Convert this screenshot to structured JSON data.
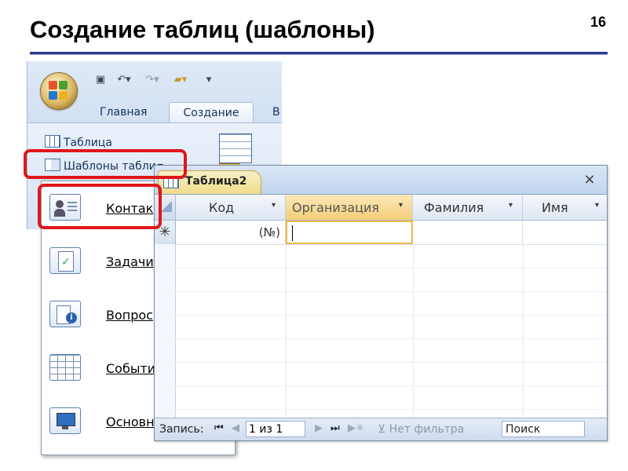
{
  "slide": {
    "title": "Создание таблиц (шаблоны)",
    "page_number": "16"
  },
  "ribbon": {
    "tabs": [
      "Главная",
      "Создание",
      "В"
    ],
    "active_tab": "Создание",
    "table_button": "Таблица",
    "templates_button": "Шаблоны табли",
    "templates_arrow": "▾"
  },
  "templates_menu": {
    "items": [
      {
        "label": "Контак",
        "icon": "contacts-card-icon"
      },
      {
        "label": "Задачи",
        "icon": "tasks-clipboard-icon"
      },
      {
        "label": "Вопрос",
        "icon": "issues-info-icon"
      },
      {
        "label": "События",
        "icon": "events-calendar-icon"
      },
      {
        "label": "Основн",
        "icon": "assets-monitor-icon"
      }
    ]
  },
  "datasheet": {
    "tab_title": "Таблица2",
    "close": "×",
    "columns": [
      "Код",
      "Организация",
      "Фамилия",
      "Имя"
    ],
    "dropdown_arrow": "▾",
    "active_column": "Организация",
    "new_row_marker": "✳",
    "new_row_id": "(№)",
    "nav": {
      "label": "Запись:",
      "first": "⏮",
      "prev": "◀",
      "position": "1 из 1",
      "next": "▶",
      "last": "⏭",
      "new": "▶✳",
      "filter": "Нет фильтра",
      "filter_icon": "⊻",
      "search": "Поиск"
    }
  },
  "colors": {
    "highlight": "#e0161b",
    "title_rule": "#2b3a8f",
    "active_header": "#f4cd79"
  }
}
